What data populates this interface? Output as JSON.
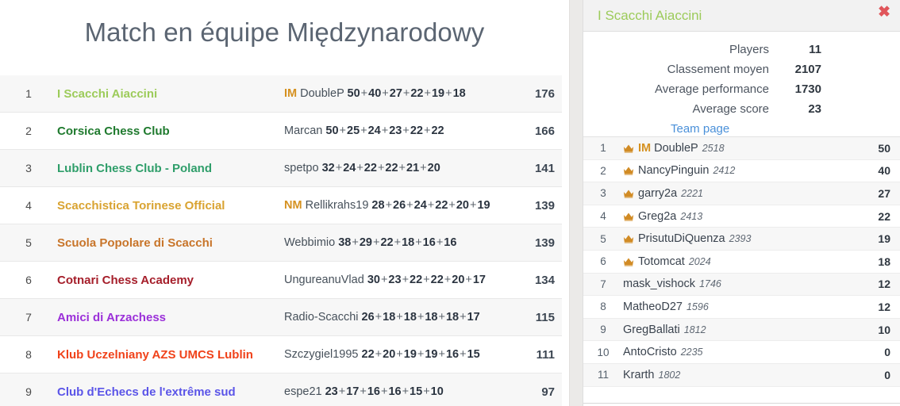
{
  "page": {
    "title": "Match en équipe Międzynarodowy"
  },
  "standings": {
    "rows": [
      {
        "rank": "1",
        "team": "I Scacchi Aiaccini",
        "color": "#9ccb5a",
        "title_tag": "IM",
        "player": "DoubleP",
        "scores": [
          "50",
          "40",
          "27",
          "22",
          "19",
          "18"
        ],
        "total": "176"
      },
      {
        "rank": "2",
        "team": "Corsica Chess Club",
        "color": "#1f7a2e",
        "title_tag": "",
        "player": "Marcan",
        "scores": [
          "50",
          "25",
          "24",
          "23",
          "22",
          "22"
        ],
        "total": "166"
      },
      {
        "rank": "3",
        "team": "Lublin Chess Club - Poland",
        "color": "#2f9e6a",
        "title_tag": "",
        "player": "spetpo",
        "scores": [
          "32",
          "24",
          "22",
          "22",
          "21",
          "20"
        ],
        "total": "141"
      },
      {
        "rank": "4",
        "team": "Scacchistica Torinese Official",
        "color": "#d9a331",
        "title_tag": "NM",
        "player": "Rellikrahs19",
        "scores": [
          "28",
          "26",
          "24",
          "22",
          "20",
          "19"
        ],
        "total": "139"
      },
      {
        "rank": "5",
        "team": "Scuola Popolare di Scacchi",
        "color": "#c8752a",
        "title_tag": "",
        "player": "Webbimio",
        "scores": [
          "38",
          "29",
          "22",
          "18",
          "16",
          "16"
        ],
        "total": "139"
      },
      {
        "rank": "6",
        "team": "Cotnari Chess Academy",
        "color": "#a51e2a",
        "title_tag": "",
        "player": "UngureanuVlad",
        "scores": [
          "30",
          "23",
          "22",
          "22",
          "20",
          "17"
        ],
        "total": "134"
      },
      {
        "rank": "7",
        "team": "Amici di Arzachess",
        "color": "#9b30d9",
        "title_tag": "",
        "player": "Radio-Scacchi",
        "scores": [
          "26",
          "18",
          "18",
          "18",
          "18",
          "17"
        ],
        "total": "115"
      },
      {
        "rank": "8",
        "team": "Klub Uczelniany AZS UMCS Lublin",
        "color": "#f0421a",
        "title_tag": "",
        "player": "Szczygiel1995",
        "scores": [
          "22",
          "20",
          "19",
          "19",
          "16",
          "15"
        ],
        "total": "111"
      },
      {
        "rank": "9",
        "team": "Club d'Echecs de l'extrême sud",
        "color": "#5b55e8",
        "title_tag": "",
        "player": "espe21",
        "scores": [
          "23",
          "17",
          "16",
          "16",
          "15",
          "10"
        ],
        "total": "97"
      }
    ]
  },
  "panel": {
    "title": "I Scacchi Aiaccini",
    "close_icon": "close-icon",
    "close_glyph": "✖",
    "stats": [
      {
        "label": "Players",
        "value": "11"
      },
      {
        "label": "Classement moyen",
        "value": "2107"
      },
      {
        "label": "Average performance",
        "value": "1730"
      },
      {
        "label": "Average score",
        "value": "23"
      }
    ],
    "team_page_link": "Team page",
    "players": [
      {
        "rank": "1",
        "crown": true,
        "title_tag": "IM",
        "name": "DoubleP",
        "rating": "2518",
        "score": "50"
      },
      {
        "rank": "2",
        "crown": true,
        "title_tag": "",
        "name": "NancyPinguin",
        "rating": "2412",
        "score": "40"
      },
      {
        "rank": "3",
        "crown": true,
        "title_tag": "",
        "name": "garry2a",
        "rating": "2221",
        "score": "27"
      },
      {
        "rank": "4",
        "crown": true,
        "title_tag": "",
        "name": "Greg2a",
        "rating": "2413",
        "score": "22"
      },
      {
        "rank": "5",
        "crown": true,
        "title_tag": "",
        "name": "PrisutuDiQuenza",
        "rating": "2393",
        "score": "19"
      },
      {
        "rank": "6",
        "crown": true,
        "title_tag": "",
        "name": "Totomcat",
        "rating": "2024",
        "score": "18"
      },
      {
        "rank": "7",
        "crown": false,
        "title_tag": "",
        "name": "mask_vishock",
        "rating": "1746",
        "score": "12"
      },
      {
        "rank": "8",
        "crown": false,
        "title_tag": "",
        "name": "MatheoD27",
        "rating": "1596",
        "score": "12"
      },
      {
        "rank": "9",
        "crown": false,
        "title_tag": "",
        "name": "GregBallati",
        "rating": "1812",
        "score": "10"
      },
      {
        "rank": "10",
        "crown": false,
        "title_tag": "",
        "name": "AntoCristo",
        "rating": "2235",
        "score": "0"
      },
      {
        "rank": "11",
        "crown": false,
        "title_tag": "",
        "name": "Krarth",
        "rating": "1802",
        "score": "0"
      }
    ]
  },
  "colors": {
    "accent_link": "#4a90d9",
    "title_tag": "#d59120",
    "crown": "#d18b24",
    "close": "#e0555a",
    "scrollbar_thumb": "#5f9ad6",
    "panel_title": "#9ccb5a"
  }
}
